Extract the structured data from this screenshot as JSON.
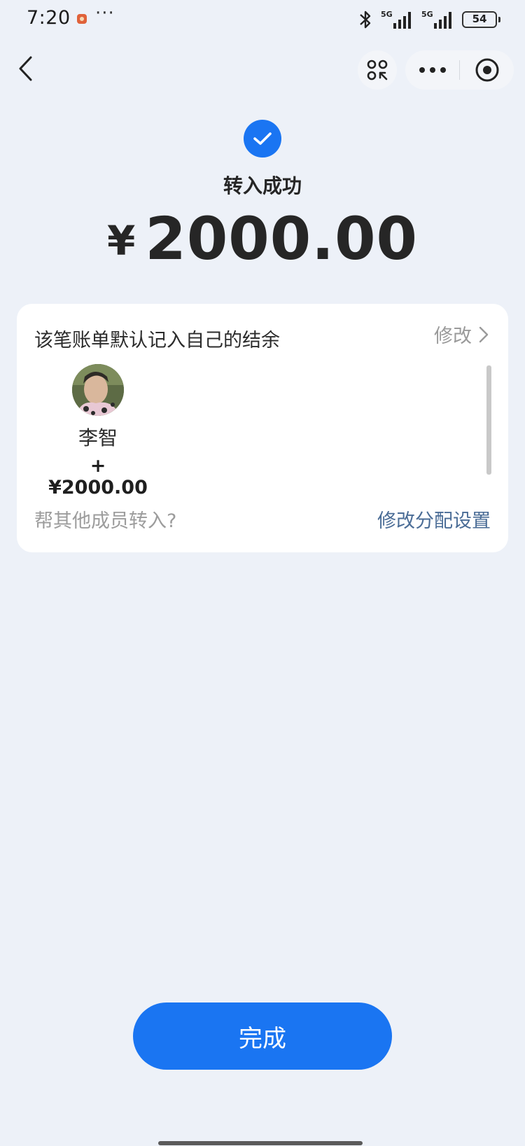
{
  "status_bar": {
    "time": "7:20",
    "dots": "···",
    "battery": "54",
    "network_label": "5G",
    "icons": [
      "app-notification-icon",
      "bluetooth-icon",
      "signal-5g-icon",
      "battery-icon"
    ]
  },
  "nav": {
    "icons": [
      "back-icon",
      "scan-icon",
      "more-icon",
      "close-miniapp-icon"
    ]
  },
  "result": {
    "title": "转入成功",
    "currency_symbol": "¥",
    "amount": "2000.00",
    "icon": "check-circle-icon",
    "accent_color": "#1a75f2"
  },
  "card": {
    "title": "该笔账单默认记入自己的结余",
    "edit_label": "修改",
    "members": [
      {
        "name": "李智",
        "amount": "+¥2000.00"
      }
    ],
    "help_text": "帮其他成员转入?",
    "setting_link": "修改分配设置",
    "link_color": "#4a6c96"
  },
  "actions": {
    "done_label": "完成"
  }
}
